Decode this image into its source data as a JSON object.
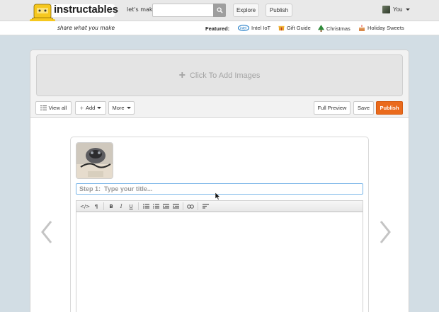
{
  "header": {
    "brand": "instructables",
    "tagline": "share what you make",
    "lets_make": "let's make",
    "search": {
      "value": "",
      "placeholder": ""
    },
    "nav": {
      "explore": "Explore",
      "publish": "Publish"
    },
    "user": {
      "name": "You"
    }
  },
  "featured": {
    "label": "Featured:",
    "items": [
      {
        "icon": "intel-logo-icon",
        "label": "Intel IoT"
      },
      {
        "icon": "gift-icon",
        "label": "Gift Guide"
      },
      {
        "icon": "christmas-tree-icon",
        "label": "Christmas"
      },
      {
        "icon": "cake-icon",
        "label": "Holiday Sweets"
      }
    ]
  },
  "editor": {
    "add_images": "Click To Add Images",
    "view_all": "View all",
    "add": "Add",
    "more": "More",
    "full_preview": "Full Preview",
    "save": "Save",
    "publish": "Publish",
    "step_title": {
      "value": "",
      "placeholder": "Step 1:  Type your title..."
    },
    "rte_buttons": [
      {
        "icon": "code-icon",
        "label": "</>"
      },
      {
        "icon": "paragraph-icon",
        "label": "¶"
      },
      {
        "icon": "bold-icon",
        "label": "B"
      },
      {
        "icon": "italic-icon",
        "label": "I"
      },
      {
        "icon": "underline-icon",
        "label": "U"
      },
      {
        "icon": "bullet-list-icon"
      },
      {
        "icon": "numbered-list-icon"
      },
      {
        "icon": "outdent-icon"
      },
      {
        "icon": "indent-icon"
      },
      {
        "icon": "link-icon"
      },
      {
        "icon": "align-icon"
      }
    ]
  },
  "colors": {
    "accent": "#ea6a1c",
    "page_bg": "#d2dde4",
    "topbar_bg": "#e9e9e9",
    "focus_border": "#7bb6e8"
  }
}
